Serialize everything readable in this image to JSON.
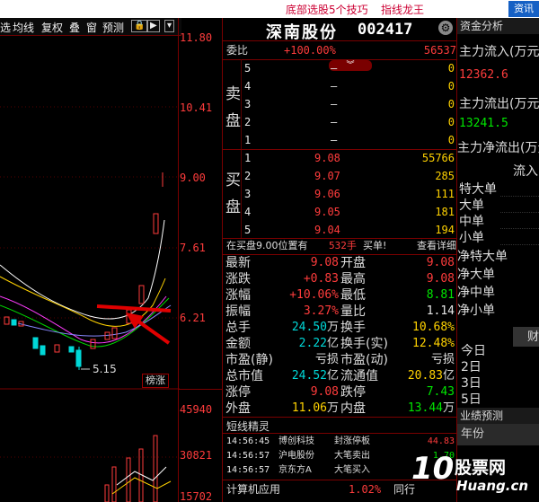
{
  "top_links": {
    "link1": "底部选股5个技巧",
    "link2": "指线龙王",
    "badge": "资讯"
  },
  "toolbar": {
    "t1": "选",
    "t2": "均线",
    "t3": "复权",
    "t4": "叠",
    "t5": "窗",
    "t6": "预测",
    "lock": "🔒",
    "play": "▶",
    "menu": "▾"
  },
  "price_axis": {
    "p1": "11.80",
    "p2": "10.41",
    "p3": "9.00",
    "p4": "7.61",
    "p5": "6.21"
  },
  "vol_axis": {
    "v1": "45940",
    "v2": "30821",
    "v3": "15702"
  },
  "chart": {
    "low_label": "5.15",
    "tag": "榜涨"
  },
  "stock": {
    "title": "深南股份",
    "code": "002417"
  },
  "weibi": {
    "label": "委比",
    "pct": "+100.00%",
    "num": "56537"
  },
  "sell_side": {
    "label1": "卖",
    "label2": "盘",
    "rows": [
      {
        "lvl": "5",
        "price": "–",
        "vol": "0"
      },
      {
        "lvl": "4",
        "price": "–",
        "vol": "0"
      },
      {
        "lvl": "3",
        "price": "–",
        "vol": "0"
      },
      {
        "lvl": "2",
        "price": "–",
        "vol": "0"
      },
      {
        "lvl": "1",
        "price": "–",
        "vol": "0"
      }
    ]
  },
  "buy_side": {
    "label1": "买",
    "label2": "盘",
    "rows": [
      {
        "lvl": "1",
        "price": "9.08",
        "vol": "55766"
      },
      {
        "lvl": "2",
        "price": "9.07",
        "vol": "285"
      },
      {
        "lvl": "3",
        "price": "9.06",
        "vol": "111"
      },
      {
        "lvl": "4",
        "price": "9.05",
        "vol": "181"
      },
      {
        "lvl": "5",
        "price": "9.04",
        "vol": "194"
      }
    ]
  },
  "notice": {
    "text": "在买盘9.00位置有",
    "vol": "532手",
    "tag": "买单!",
    "link": "查看详细"
  },
  "quotes": [
    {
      "l1": "最新",
      "v1": "9.08",
      "l2": "开盘",
      "v2": "9.08"
    },
    {
      "l1": "涨跌",
      "v1": "+0.83",
      "l2": "最高",
      "v2": "9.08"
    },
    {
      "l1": "涨幅",
      "v1": "+10.06%",
      "l2": "最低",
      "v2": "8.81"
    },
    {
      "l1": "振幅",
      "v1": "3.27%",
      "l2": "量比",
      "v2": "1.14"
    },
    {
      "l1": "总手",
      "v1": "24.50",
      "u1": "万",
      "l2": "换手",
      "v2": "10.68%"
    },
    {
      "l1": "金额",
      "v1": "2.22",
      "u1": "亿",
      "l2": "换手(实)",
      "v2": "12.48%"
    },
    {
      "l1": "市盈(静)",
      "v1": "亏损",
      "l2": "市盈(动)",
      "v2": "亏损"
    },
    {
      "l1": "总市值",
      "v1": "24.52",
      "u1": "亿",
      "l2": "流通值",
      "v2": "20.83",
      "u2": "亿"
    },
    {
      "l1": "涨停",
      "v1": "9.08",
      "l2": "跌停",
      "v2": "7.43"
    },
    {
      "l1": "外盘",
      "v1": "11.06",
      "u1": "万",
      "l2": "内盘",
      "v2": "13.44",
      "u2": "万"
    }
  ],
  "short_elves": {
    "title": "短线精灵",
    "rows": [
      {
        "time": "14:56:45",
        "name": "博创科技",
        "event": "封涨停板",
        "val": "44.83"
      },
      {
        "time": "14:56:57",
        "name": "沪电股份",
        "event": "大笔卖出",
        "val": "1.70"
      },
      {
        "time": "14:56:57",
        "name": "京东方A",
        "event": "大笔买入",
        "val": ""
      }
    ]
  },
  "bottom_bar": {
    "b1": "计算机应用",
    "b2": "1.02%",
    "b3": "同行"
  },
  "right_panel": {
    "title": "资金分析",
    "in_label": "主力流入(万元)",
    "in_val": "12362.6",
    "out_label": "主力流出(万元)",
    "out_val": "13241.5",
    "net_label": "主力净流出(万元)",
    "flow_hdr": "流入",
    "rows": [
      "特大单",
      "大单",
      "中单",
      "小单"
    ],
    "net_rows": [
      "净特大单",
      "净大单",
      "净中单",
      "净小单"
    ],
    "days": [
      "今日",
      "2日",
      "3日",
      "5日"
    ],
    "forecast": "业绩预测",
    "year": "年份",
    "right_partial": "财"
  },
  "watermark": {
    "num": "10",
    "text": "股票网",
    "url": "Huang.cn"
  }
}
